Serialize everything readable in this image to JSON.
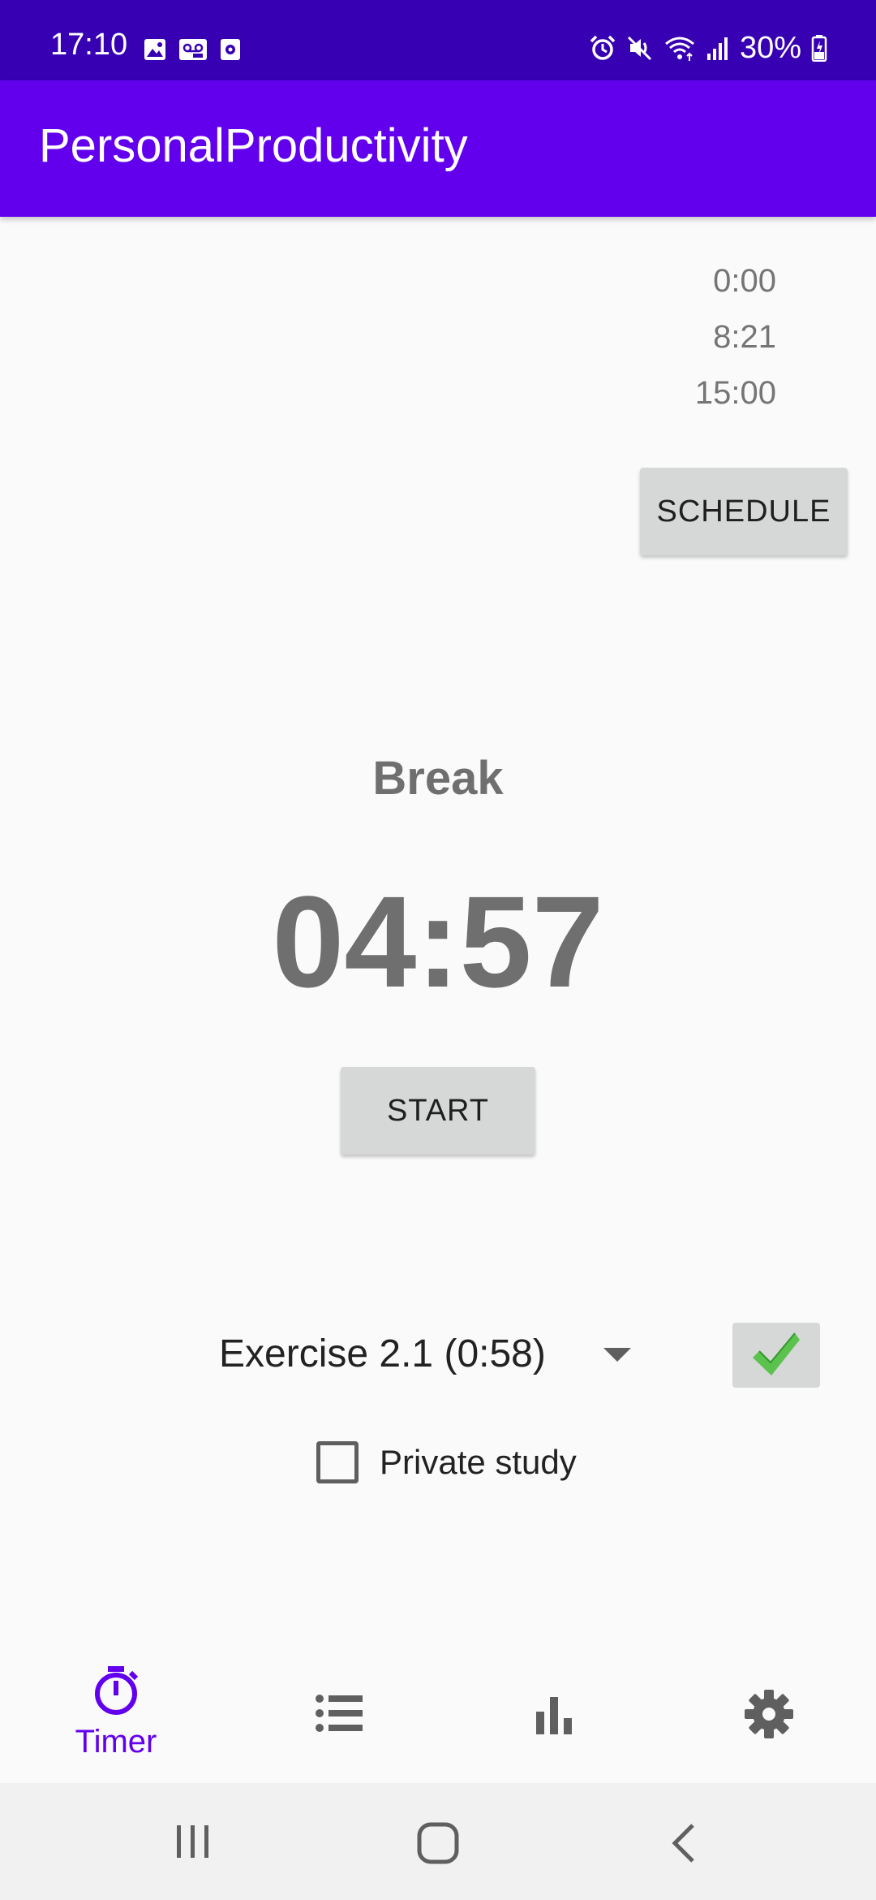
{
  "status_bar": {
    "time": "17:10",
    "battery": "30%",
    "left_icons": [
      "image-icon",
      "voicemail-icon",
      "media-icon"
    ],
    "right_icons": [
      "alarm-icon",
      "mute-icon",
      "wifi-icon",
      "signal-icon",
      "battery-icon"
    ]
  },
  "app_bar": {
    "title": "PersonalProductivity",
    "color": "#6200ee"
  },
  "schedule": {
    "times": [
      "0:00",
      "8:21",
      "15:00"
    ],
    "button_label": "SCHEDULE"
  },
  "timer": {
    "mode": "Break",
    "display": "04:57",
    "start_label": "START"
  },
  "task": {
    "selected": "Exercise 2.1 (0:58)",
    "confirm_icon": "checkmark-icon"
  },
  "private_study": {
    "label": "Private study",
    "checked": false
  },
  "bottom_nav": {
    "items": [
      {
        "icon": "stopwatch-icon",
        "label": "Timer",
        "active": true
      },
      {
        "icon": "list-icon",
        "label": "",
        "active": false
      },
      {
        "icon": "bar-chart-icon",
        "label": "",
        "active": false
      },
      {
        "icon": "gear-icon",
        "label": "",
        "active": false
      }
    ],
    "active_color": "#6200ee"
  },
  "system_nav": [
    "recents-icon",
    "home-icon",
    "back-icon"
  ]
}
